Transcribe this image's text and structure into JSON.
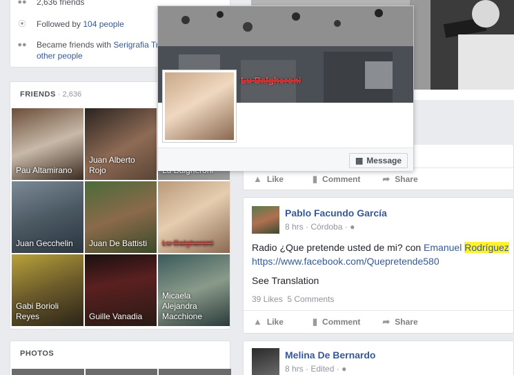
{
  "intro": {
    "friends_count_text": "2,636 friends",
    "followed_prefix": "Followed by ",
    "followed_count": "104 people",
    "became_friends_prefix": "Became friends with ",
    "became_friends_name": "Serigrafia Tr",
    "became_friends_suffix": "other people"
  },
  "friends": {
    "title": "FRIENDS",
    "sep": " · ",
    "count": "2,636",
    "tiles": [
      {
        "name": "Pau Altamirano"
      },
      {
        "name": "Juan Alberto Rojo"
      },
      {
        "name": "Lu Balgheroni"
      },
      {
        "name": "Juan Gecchelin"
      },
      {
        "name": "Juan De Battisti"
      },
      {
        "name": "Lu Balgheroni"
      },
      {
        "name": "Gabi Borioli Reyes"
      },
      {
        "name": "Guille Vanadia"
      },
      {
        "name": "Micaela Alejandra Macchione"
      }
    ]
  },
  "photos": {
    "title": "PHOTOS"
  },
  "hovercard": {
    "name": "Lu Balgheroni",
    "message_label": "Message"
  },
  "post_top": {
    "like": "Like",
    "comment": "Comment",
    "share": "Share"
  },
  "post1": {
    "author": "Pablo Facundo García",
    "time": "8 hrs",
    "sep": " · ",
    "location": "Córdoba",
    "text_prefix": "Radio ¿Que pretende usted de mi? con ",
    "mention_first": "Emanuel ",
    "mention_highlight": "Rodríguez",
    "link": "https://www.facebook.com/Quepretende580",
    "see_translation": "See Translation",
    "likes": "39 Likes",
    "comments": "5 Comments",
    "like": "Like",
    "comment": "Comment",
    "share": "Share"
  },
  "post2": {
    "author": "Melina De Bernardo",
    "time": "8 hrs",
    "sep": " · ",
    "edited": "Edited"
  },
  "colors": {
    "link_blue": "#365899",
    "page_bg": "#e9ebee",
    "highlight": "#fff22d",
    "strike_red": "#d23030"
  }
}
